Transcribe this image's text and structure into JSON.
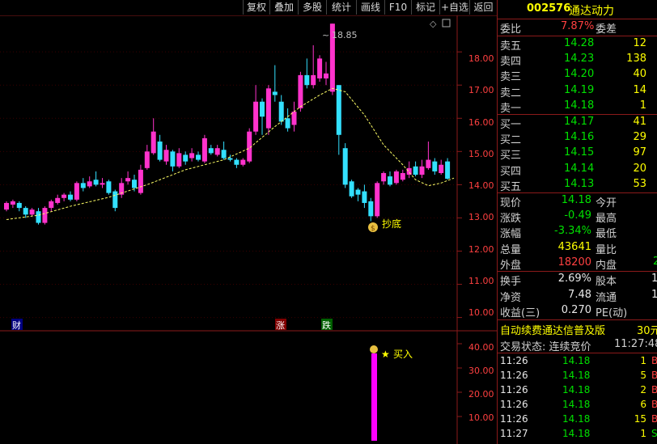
{
  "toolbar": {
    "buttons": [
      "复权",
      "叠加",
      "多股",
      "统计",
      "画线",
      "F10",
      "标记",
      "+自选",
      "返回"
    ]
  },
  "main_chart": {
    "max_label": "18.85",
    "y_ticks": [
      "18.00",
      "17.00",
      "16.00",
      "15.00",
      "14.00",
      "13.00",
      "12.00",
      "11.00",
      "10.00"
    ],
    "markers": {
      "cai": "财",
      "zhang": "涨",
      "die": "跌"
    },
    "chaodi_label": "抄底"
  },
  "sub_chart": {
    "y_ticks": [
      "40.00",
      "30.00",
      "20.00",
      "10.00"
    ],
    "buy_label": "买入"
  },
  "chart_data": {
    "type": "candlestick",
    "ylim": [
      9.6,
      19.1
    ],
    "candles": [
      [
        13.25,
        13.45,
        13.2,
        13.5
      ],
      [
        13.4,
        13.5,
        13.3,
        13.55
      ],
      [
        13.45,
        13.3,
        13.2,
        13.5
      ],
      [
        13.3,
        13.1,
        13.0,
        13.35
      ],
      [
        13.1,
        13.25,
        13.05,
        13.3
      ],
      [
        13.2,
        12.85,
        12.8,
        13.3
      ],
      [
        12.85,
        13.3,
        12.8,
        13.35
      ],
      [
        13.3,
        13.5,
        13.2,
        13.55
      ],
      [
        13.45,
        13.6,
        13.4,
        13.7
      ],
      [
        13.6,
        13.7,
        13.5,
        13.75
      ],
      [
        13.7,
        13.55,
        13.5,
        13.8
      ],
      [
        13.55,
        14.05,
        13.5,
        14.1
      ],
      [
        14.05,
        13.9,
        13.8,
        14.2
      ],
      [
        13.95,
        14.1,
        13.9,
        14.25
      ],
      [
        14.15,
        14.0,
        13.95,
        14.4
      ],
      [
        14.0,
        14.05,
        13.9,
        14.2
      ],
      [
        14.1,
        13.75,
        13.7,
        14.15
      ],
      [
        13.8,
        13.3,
        13.2,
        13.85
      ],
      [
        13.7,
        14.05,
        13.6,
        14.2
      ],
      [
        14.1,
        14.2,
        14.0,
        14.4
      ],
      [
        14.15,
        13.9,
        13.8,
        14.3
      ],
      [
        13.75,
        14.45,
        13.7,
        14.6
      ],
      [
        14.5,
        15.0,
        14.45,
        15.2
      ],
      [
        14.95,
        15.6,
        14.9,
        16.0
      ],
      [
        15.3,
        14.75,
        14.7,
        15.5
      ],
      [
        14.7,
        15.05,
        14.6,
        15.2
      ],
      [
        15.0,
        14.55,
        14.4,
        15.05
      ],
      [
        14.55,
        14.95,
        14.5,
        15.1
      ],
      [
        14.9,
        14.7,
        14.6,
        15.0
      ],
      [
        14.8,
        14.95,
        14.7,
        15.1
      ],
      [
        14.9,
        14.75,
        14.7,
        15.0
      ],
      [
        14.7,
        15.4,
        14.65,
        15.5
      ],
      [
        15.1,
        14.95,
        14.9,
        15.2
      ],
      [
        14.9,
        15.1,
        14.85,
        15.2
      ],
      [
        15.05,
        14.8,
        14.75,
        15.3
      ],
      [
        14.8,
        14.75,
        14.7,
        14.9
      ],
      [
        14.75,
        14.6,
        14.5,
        14.8
      ],
      [
        14.6,
        14.75,
        14.55,
        14.8
      ],
      [
        14.7,
        15.6,
        14.65,
        15.7
      ],
      [
        15.6,
        16.5,
        15.5,
        17.0
      ],
      [
        16.5,
        16.05,
        15.5,
        16.6
      ],
      [
        15.7,
        16.9,
        15.5,
        17.0
      ],
      [
        16.8,
        16.7,
        16.5,
        17.6
      ],
      [
        16.5,
        15.9,
        15.8,
        16.7
      ],
      [
        16.0,
        15.7,
        15.6,
        16.3
      ],
      [
        15.8,
        16.2,
        15.6,
        16.5
      ],
      [
        16.3,
        17.3,
        16.2,
        17.4
      ],
      [
        17.3,
        17.0,
        16.9,
        17.8
      ],
      [
        17.0,
        17.3,
        16.9,
        18.2
      ],
      [
        17.2,
        17.8,
        17.1,
        17.9
      ],
      [
        17.2,
        17.35,
        17.0,
        17.7
      ],
      [
        16.8,
        18.85,
        16.7,
        18.85
      ],
      [
        17.0,
        15.5,
        14.9,
        17.0
      ],
      [
        15.1,
        14.0,
        13.9,
        15.25
      ],
      [
        14.1,
        13.65,
        13.6,
        14.15
      ],
      [
        13.85,
        13.7,
        13.5,
        13.9
      ],
      [
        13.8,
        13.45,
        13.3,
        14.0
      ],
      [
        13.5,
        13.05,
        12.9,
        13.6
      ],
      [
        13.05,
        14.05,
        13.0,
        14.1
      ],
      [
        14.1,
        14.35,
        14.0,
        14.4
      ],
      [
        14.25,
        14.0,
        13.95,
        14.4
      ],
      [
        14.05,
        14.4,
        14.0,
        14.45
      ],
      [
        14.15,
        14.35,
        14.1,
        14.45
      ],
      [
        14.3,
        14.5,
        14.2,
        14.7
      ],
      [
        14.55,
        14.3,
        14.25,
        14.7
      ],
      [
        14.3,
        14.55,
        14.2,
        14.75
      ],
      [
        14.5,
        14.75,
        14.45,
        15.3
      ],
      [
        14.7,
        14.4,
        14.3,
        14.8
      ],
      [
        14.35,
        14.6,
        14.3,
        14.75
      ],
      [
        14.7,
        14.18,
        14.15,
        14.8
      ]
    ],
    "ma": [
      [
        0,
        12.95
      ],
      [
        5,
        13.08
      ],
      [
        10,
        13.35
      ],
      [
        16,
        13.62
      ],
      [
        22,
        14.0
      ],
      [
        28,
        14.45
      ],
      [
        34,
        14.75
      ],
      [
        38,
        15.1
      ],
      [
        42,
        15.75
      ],
      [
        46,
        16.35
      ],
      [
        49,
        16.7
      ],
      [
        51,
        16.9
      ],
      [
        53,
        16.8
      ],
      [
        56,
        16.1
      ],
      [
        59,
        15.2
      ],
      [
        62,
        14.6
      ],
      [
        64,
        14.15
      ],
      [
        66,
        13.97
      ],
      [
        68,
        14.05
      ],
      [
        70,
        14.2
      ]
    ],
    "sub_volume": 36.0
  },
  "quote": {
    "code": "002576",
    "name": "通达动力",
    "weibi_label": "委比",
    "weibi_value": "7.87%",
    "weicha_label": "委差",
    "asks": [
      {
        "label": "卖五",
        "price": "14.28",
        "vol": "12"
      },
      {
        "label": "卖四",
        "price": "14.23",
        "vol": "138"
      },
      {
        "label": "卖三",
        "price": "14.20",
        "vol": "40"
      },
      {
        "label": "卖二",
        "price": "14.19",
        "vol": "14"
      },
      {
        "label": "卖一",
        "price": "14.18",
        "vol": "1"
      }
    ],
    "bids": [
      {
        "label": "买一",
        "price": "14.17",
        "vol": "41"
      },
      {
        "label": "买二",
        "price": "14.16",
        "vol": "29"
      },
      {
        "label": "买三",
        "price": "14.15",
        "vol": "97"
      },
      {
        "label": "买四",
        "price": "14.14",
        "vol": "20"
      },
      {
        "label": "买五",
        "price": "14.13",
        "vol": "53"
      }
    ],
    "stats": [
      {
        "l1": "现价",
        "v1": "14.18",
        "l2": "今开",
        "c": "dn"
      },
      {
        "l1": "涨跌",
        "v1": "-0.49",
        "l2": "最高",
        "c": "dn"
      },
      {
        "l1": "涨幅",
        "v1": "-3.34%",
        "l2": "最低",
        "c": "dn"
      },
      {
        "l1": "总量",
        "v1": "43641",
        "l2": "量比",
        "c": "yl"
      },
      {
        "l1": "外盘",
        "v1": "18200",
        "l2": "内盘",
        "c": "up"
      }
    ],
    "inner_disc_partial": "2",
    "stats2": [
      {
        "l1": "换手",
        "v1": "2.69%",
        "l2": "股本",
        "v2": "1"
      },
      {
        "l1": "净资",
        "v1": "7.48",
        "l2": "流通",
        "v2": "1"
      },
      {
        "l1": "收益(三)",
        "v1": "0.270",
        "l2": "PE(动)",
        "v2": ""
      }
    ],
    "ad_text": "自动续费通达信普及版",
    "ad_price": "30元",
    "trade_status": "交易状态: 连续竞价",
    "trade_time": "11:27:48",
    "ticks": [
      {
        "time": "11:26",
        "price": "14.18",
        "vol": "1",
        "dir": "B"
      },
      {
        "time": "11:26",
        "price": "14.18",
        "vol": "5",
        "dir": "B"
      },
      {
        "time": "11:26",
        "price": "14.18",
        "vol": "2",
        "dir": "B"
      },
      {
        "time": "11:26",
        "price": "14.18",
        "vol": "6",
        "dir": "B"
      },
      {
        "time": "11:26",
        "price": "14.18",
        "vol": "15",
        "dir": "B"
      },
      {
        "time": "11:27",
        "price": "14.18",
        "vol": "1",
        "dir": "S"
      }
    ]
  }
}
